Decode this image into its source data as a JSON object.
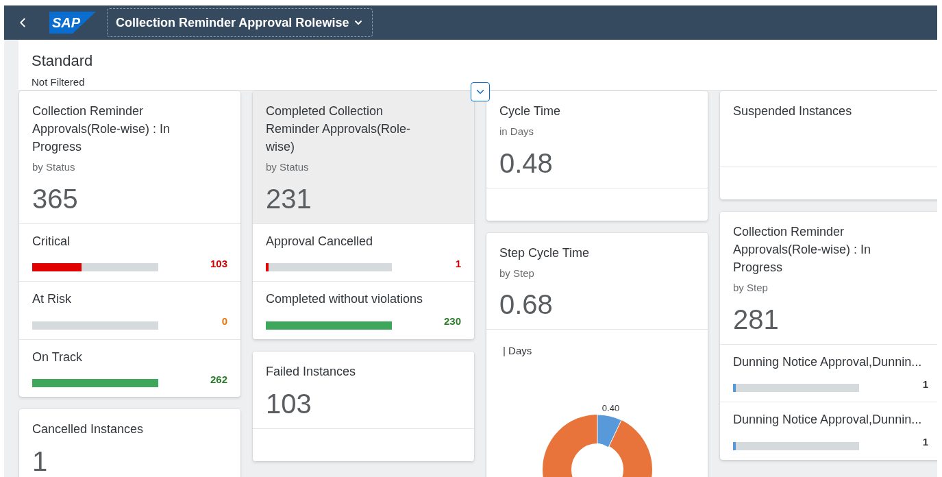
{
  "shell": {
    "logo": "SAP",
    "title": "Collection Reminder Approval Rolewise"
  },
  "header": {
    "variant": "Standard",
    "filter_status": "Not Filtered"
  },
  "columns": [
    [
      {
        "title": "Collection Reminder Approvals(Role-wise) : In Progress",
        "subtitle": "by Status",
        "value": "365",
        "highlighted": false,
        "items": [
          {
            "label": "Critical",
            "value": "103",
            "level": 0.39,
            "kind": "error"
          },
          {
            "label": "At Risk",
            "value": "0",
            "kind": "warning"
          },
          {
            "label": "On Track",
            "value": "262",
            "level": 1,
            "kind": "good"
          }
        ]
      },
      {
        "title": "Cancelled Instances",
        "value": "1",
        "highlighted": false
      }
    ],
    [
      {
        "title": "Completed Collection Reminder Approvals(Role-wise)",
        "subtitle": "by Status",
        "value": "231",
        "highlighted": true,
        "items": [
          {
            "label": "Approval Cancelled",
            "value": "1",
            "level": 0.02,
            "kind": "error"
          },
          {
            "label": "Completed without violations",
            "value": "230",
            "level": 1,
            "kind": "good"
          }
        ]
      },
      {
        "title": "Failed Instances",
        "value": "103",
        "highlighted": false
      }
    ],
    [
      {
        "title": "Cycle Time",
        "subtitle": "in Days",
        "value": "0.48",
        "highlighted": false
      },
      {
        "title": "Step Cycle Time",
        "subtitle": "by Step",
        "value": "0.68",
        "highlighted": false,
        "chart": {
          "legend": "| Days",
          "label": "0.40"
        }
      }
    ],
    [
      {
        "title": "Suspended Instances",
        "highlighted": false
      },
      {
        "title": "Collection Reminder Approvals(Role-wise) : In Progress",
        "subtitle": "by Step",
        "value": "281",
        "highlighted": false,
        "items": [
          {
            "label": "Dunning Notice Approval,Dunnin...",
            "value": "1",
            "level": 0.02,
            "kind": "info"
          },
          {
            "label": "Dunning Notice Approval,Dunnin...",
            "value": "1",
            "level": 0.02,
            "kind": "info"
          }
        ]
      }
    ]
  ]
}
